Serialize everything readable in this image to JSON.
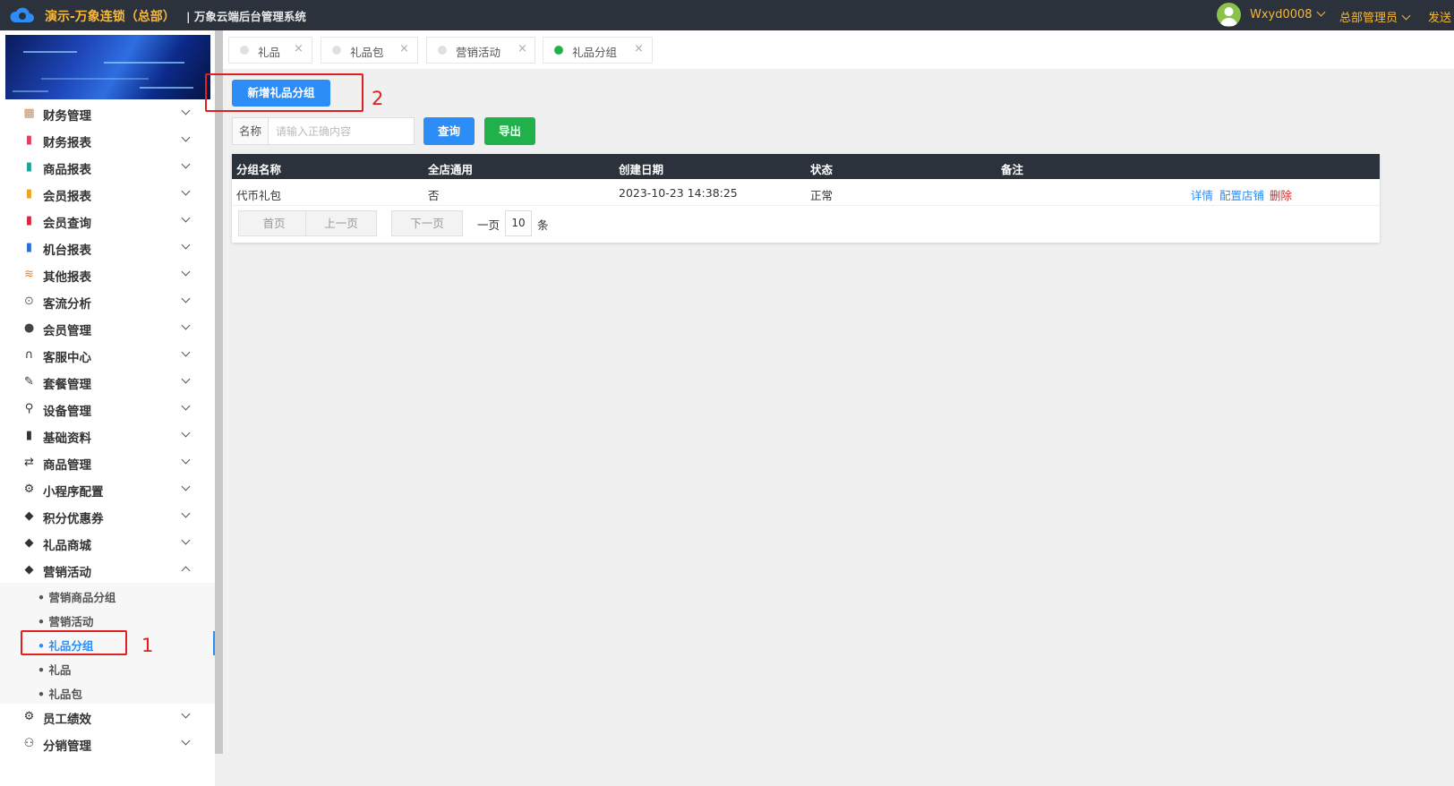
{
  "header": {
    "brand": "演示-万象连锁（总部）",
    "subtitle": "| 万象云端后台管理系统",
    "user_name": "Wxyd0008",
    "role": "总部管理员",
    "send": "发送",
    "colors": {
      "bar": "#2b323b",
      "accent": "#f6b73c"
    }
  },
  "sidebar": {
    "items": [
      {
        "label": "财务管理",
        "icon": "calculator-icon"
      },
      {
        "label": "财务报表",
        "icon": "chart-icon"
      },
      {
        "label": "商品报表",
        "icon": "chart-icon"
      },
      {
        "label": "会员报表",
        "icon": "chart-icon"
      },
      {
        "label": "会员查询",
        "icon": "chart-icon"
      },
      {
        "label": "机台报表",
        "icon": "chart-icon"
      },
      {
        "label": "其他报表",
        "icon": "layers-icon"
      },
      {
        "label": "客流分析",
        "icon": "target-icon"
      },
      {
        "label": "会员管理",
        "icon": "user-icon"
      },
      {
        "label": "客服中心",
        "icon": "headset-icon"
      },
      {
        "label": "套餐管理",
        "icon": "edit-icon"
      },
      {
        "label": "设备管理",
        "icon": "joystick-icon"
      },
      {
        "label": "基础资料",
        "icon": "file-icon"
      },
      {
        "label": "商品管理",
        "icon": "swap-icon"
      },
      {
        "label": "小程序配置",
        "icon": "gear-icon"
      },
      {
        "label": "积分优惠券",
        "icon": "tag-icon"
      },
      {
        "label": "礼品商城",
        "icon": "tag-icon"
      },
      {
        "label": "营销活动",
        "icon": "tag-icon"
      }
    ],
    "sub_items": [
      "• 营销商品分组",
      "• 营销活动",
      "• 礼品分组",
      "• 礼品",
      "• 礼品包"
    ],
    "bottom_items": [
      {
        "label": "员工绩效",
        "icon": "gear-icon"
      },
      {
        "label": "分销管理",
        "icon": "users-icon"
      }
    ]
  },
  "tabs": [
    {
      "label": "礼品",
      "close": "×"
    },
    {
      "label": "礼品包",
      "close": "×"
    },
    {
      "label": "营销活动",
      "close": "×"
    },
    {
      "label": "礼品分组",
      "close": "×"
    }
  ],
  "toolbar": {
    "add_button": "新增礼品分组",
    "search_label": "名称",
    "search_placeholder": "请输入正确内容",
    "query_button": "查询",
    "export_button": "导出",
    "colors": {
      "primary": "#2b8df5",
      "success": "#21b14b"
    }
  },
  "annotations": {
    "mark1": "1",
    "mark2": "2",
    "color": "#e02020"
  },
  "table": {
    "columns": [
      "分组名称",
      "全店通用",
      "创建日期",
      "状态",
      "备注"
    ],
    "rows": [
      {
        "name": "代币礼包",
        "all_store": "否",
        "created": "2023-10-23 14:38:25",
        "status": "正常",
        "remark": ""
      }
    ],
    "actions": {
      "detail": "详情",
      "config": "配置店铺",
      "delete": "删除"
    }
  },
  "pagination": {
    "first": "首页",
    "prev": "上一页",
    "next": "下一页",
    "per_page_prefix": "一页",
    "page_size": "10",
    "per_page_suffix": "条"
  }
}
